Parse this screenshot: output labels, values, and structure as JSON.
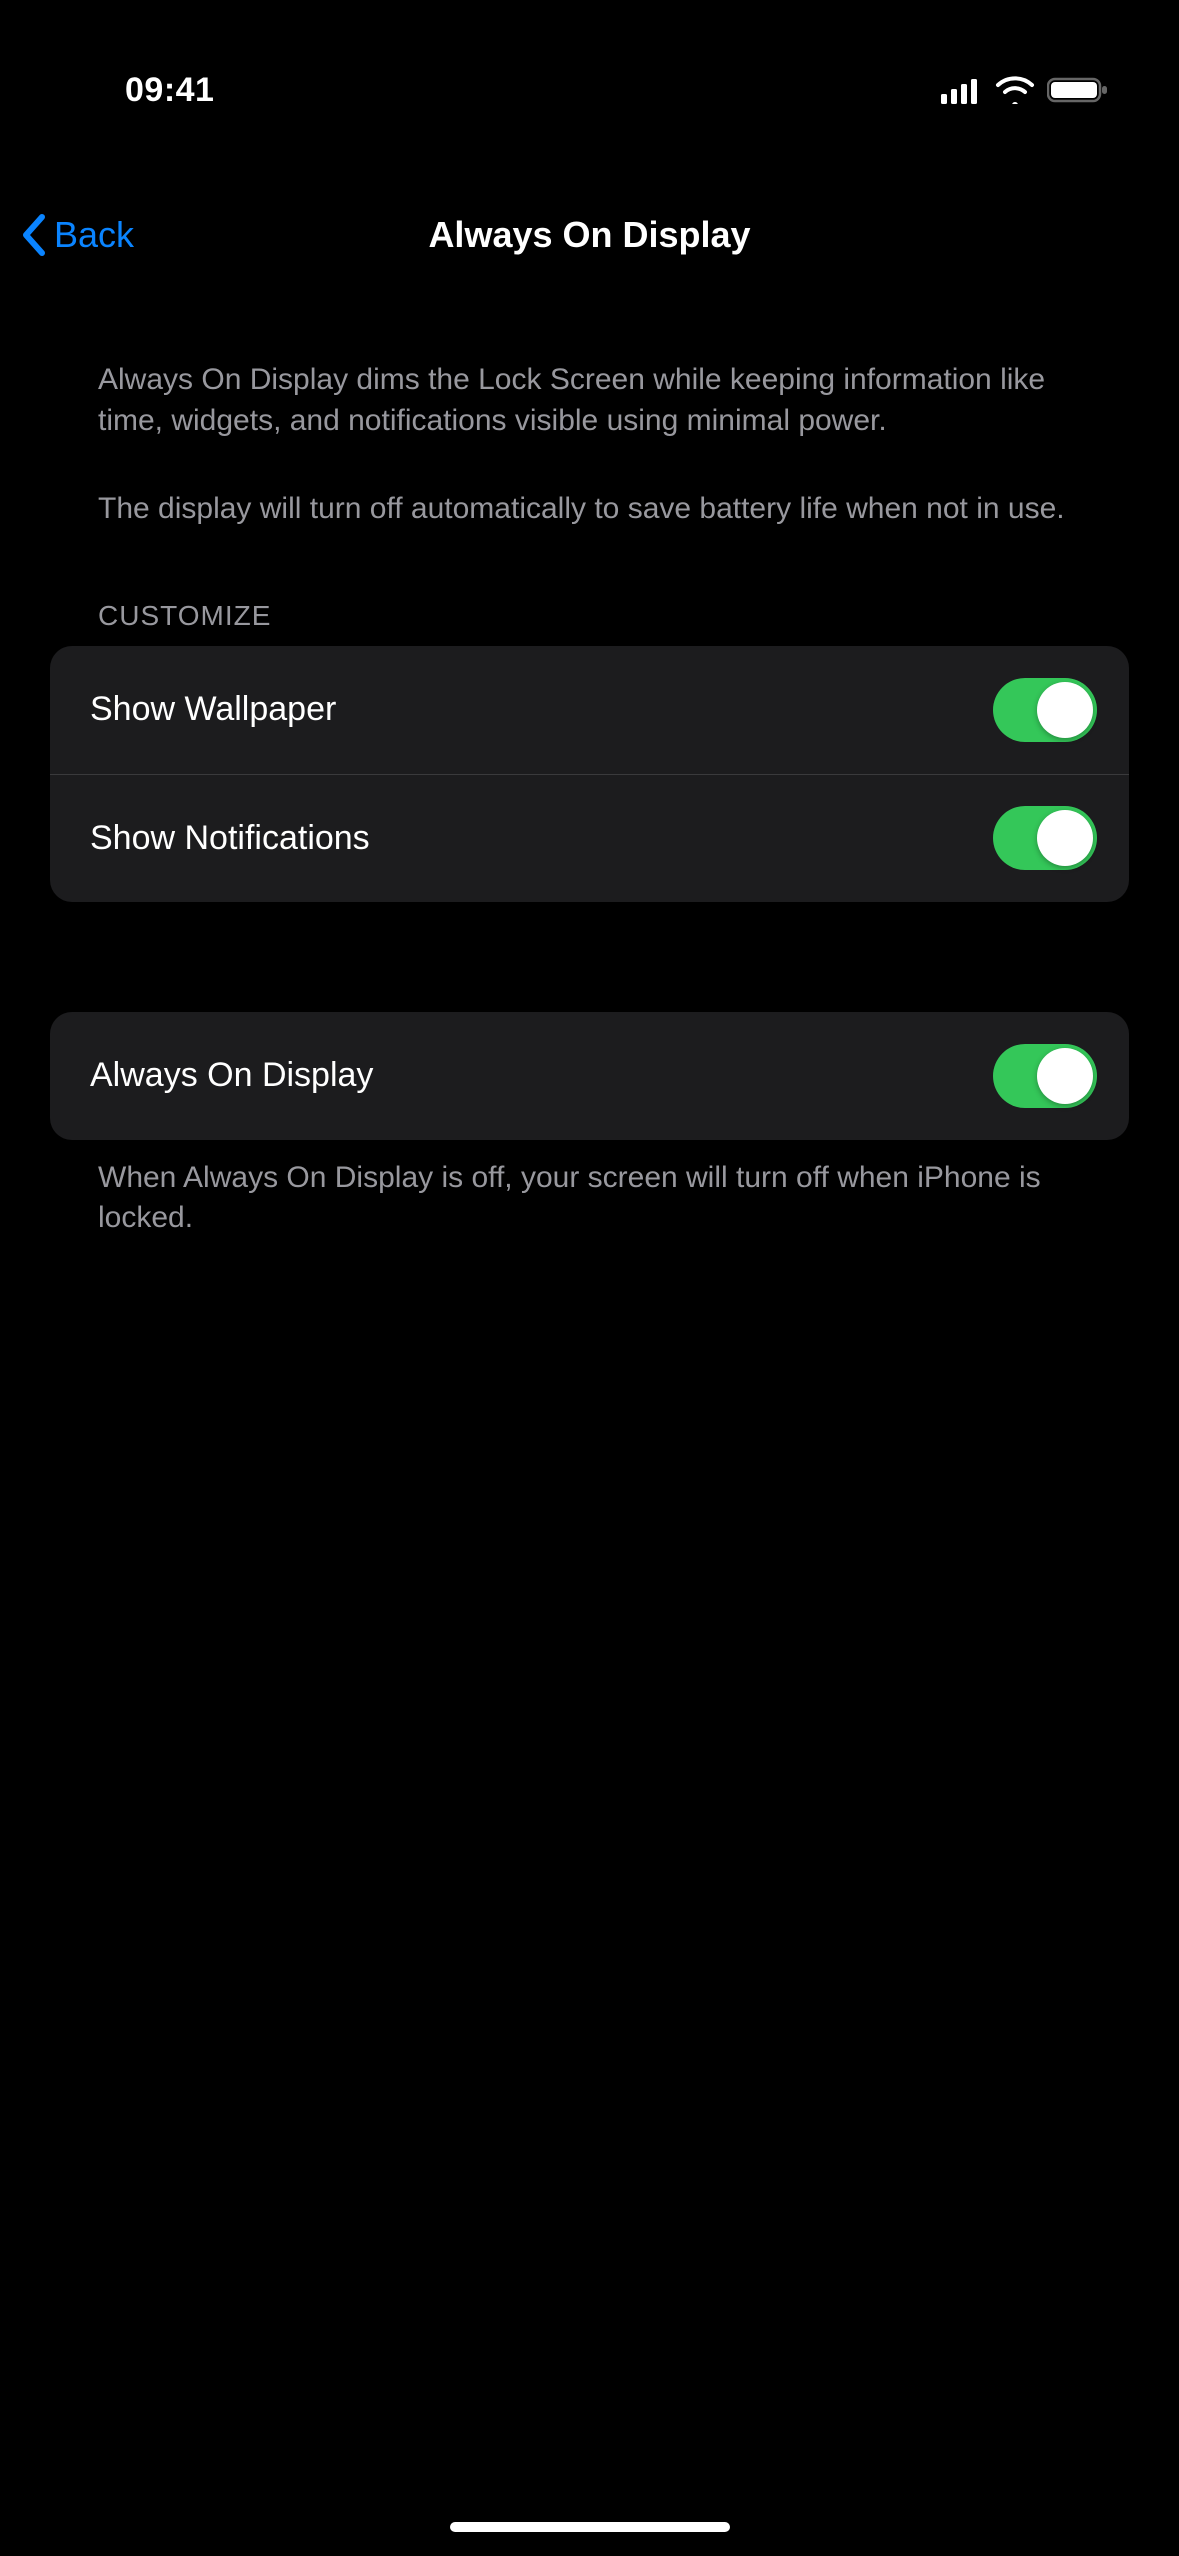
{
  "status": {
    "time": "09:41"
  },
  "nav": {
    "back_label": "Back",
    "title": "Always On Display"
  },
  "intro": {
    "p1": "Always On Display dims the Lock Screen while keeping information like time, widgets, and notifications visible using minimal power.",
    "p2": "The display will turn off automatically to save battery life when not in use."
  },
  "sections": {
    "customize_header": "CUSTOMIZE",
    "customize_rows": [
      {
        "label": "Show Wallpaper",
        "on": true
      },
      {
        "label": "Show Notifications",
        "on": true
      }
    ],
    "main_row": {
      "label": "Always On Display",
      "on": true
    },
    "footer": "When Always On Display is off, your screen will turn off when iPhone is locked."
  }
}
